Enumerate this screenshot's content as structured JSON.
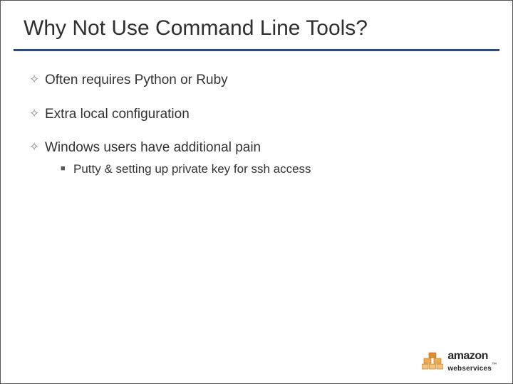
{
  "title": "Why Not Use Command Line Tools?",
  "bullets": [
    {
      "text": "Often requires Python or Ruby"
    },
    {
      "text": "Extra local configuration"
    },
    {
      "text": "Windows users have additional pain",
      "sub": [
        "Putty & setting up private key for ssh access"
      ]
    }
  ],
  "logo": {
    "top": "amazon",
    "bottom": "webservices",
    "tm": "™"
  }
}
